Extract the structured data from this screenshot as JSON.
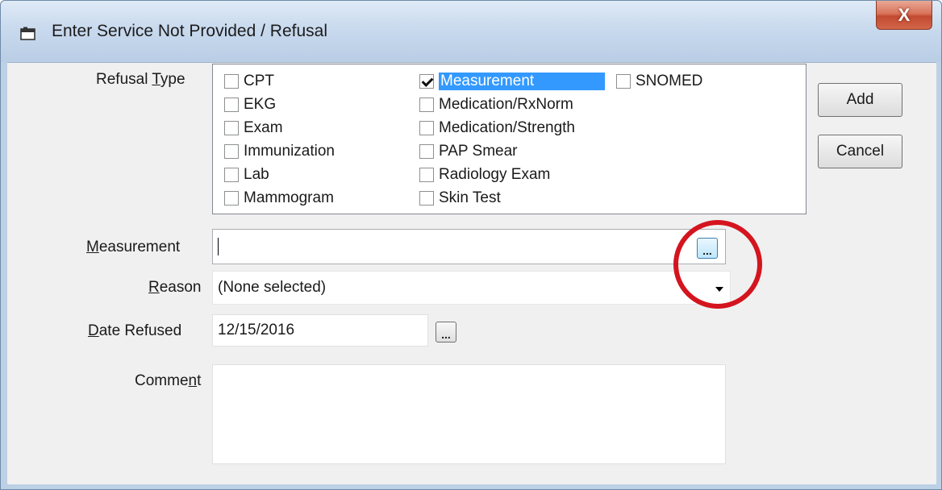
{
  "window": {
    "title": "Enter Service Not Provided / Refusal",
    "close_label": "X"
  },
  "refusal_type": {
    "label_pre": "Refusal ",
    "label_key": "T",
    "label_post": "ype",
    "options": [
      {
        "label": "CPT",
        "checked": false
      },
      {
        "label": "EKG",
        "checked": false
      },
      {
        "label": "Exam",
        "checked": false
      },
      {
        "label": "Immunization",
        "checked": false
      },
      {
        "label": "Lab",
        "checked": false
      },
      {
        "label": "Mammogram",
        "checked": false
      },
      {
        "label": "Measurement",
        "checked": true,
        "selected": true
      },
      {
        "label": "Medication/RxNorm",
        "checked": false
      },
      {
        "label": "Medication/Strength",
        "checked": false
      },
      {
        "label": "PAP Smear",
        "checked": false
      },
      {
        "label": "Radiology Exam",
        "checked": false
      },
      {
        "label": "Skin Test",
        "checked": false
      },
      {
        "label": "SNOMED",
        "checked": false
      }
    ]
  },
  "buttons": {
    "add": "Add",
    "cancel": "Cancel"
  },
  "measurement": {
    "label_key": "M",
    "label_post": "easurement",
    "value": "",
    "lookup_label": "..."
  },
  "reason": {
    "label_key": "R",
    "label_post": "eason",
    "value": "(None selected)"
  },
  "date_refused": {
    "label_key": "D",
    "label_post": "ate Refused",
    "value": "12/15/2016",
    "picker_label": "..."
  },
  "comment": {
    "label_pre": "Comme",
    "label_key": "n",
    "label_post": "t",
    "value": ""
  },
  "colors": {
    "highlight_ring": "#d4141e",
    "selection": "#3399ff"
  }
}
